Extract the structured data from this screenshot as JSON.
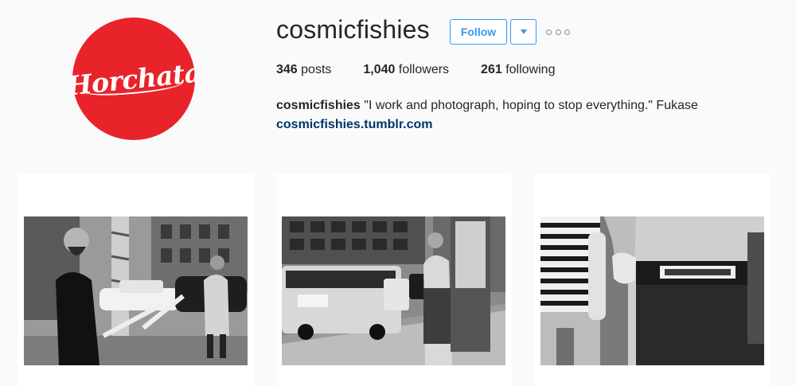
{
  "profile": {
    "avatar_text": "Horchata",
    "username": "cosmicfishies",
    "follow_label": "Follow",
    "dropdown_icon": "chevron-down-icon",
    "more_icon": "more-options-icon",
    "stats": {
      "posts_count": "346",
      "posts_label": "posts",
      "followers_count": "1,040",
      "followers_label": "followers",
      "following_count": "261",
      "following_label": "following"
    },
    "bio_name": "cosmicfishies",
    "bio_text": "\"I work and photograph, hoping to stop everything.\" Fukase",
    "bio_link": "cosmicfishies.tumblr.com"
  },
  "colors": {
    "accent": "#3897f0",
    "avatar_red": "#e8232a",
    "link": "#003569"
  }
}
